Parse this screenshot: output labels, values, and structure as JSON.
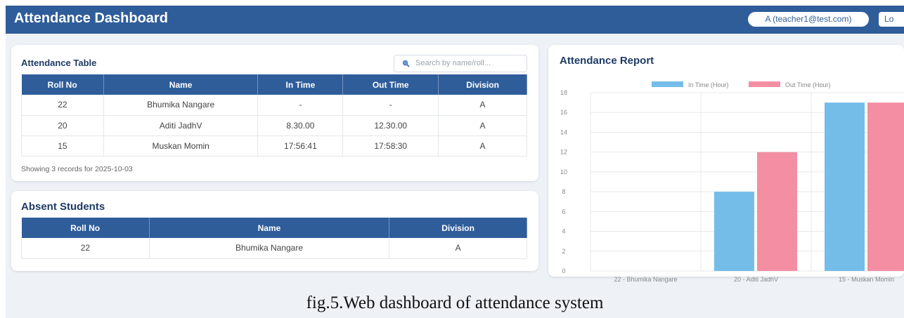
{
  "header": {
    "title": "Attendance Dashboard",
    "user_label": "A (teacher1@test.com)",
    "logout_label": "Lo"
  },
  "attendance_table": {
    "title": "Attendance Table",
    "search_placeholder": "Search by name/roll...",
    "columns": [
      "Roll No",
      "Name",
      "In Time",
      "Out Time",
      "Division"
    ],
    "rows": [
      [
        "22",
        "Bhumika Nangare",
        "-",
        "-",
        "A"
      ],
      [
        "20",
        "Aditi JadhV",
        "8.30.00",
        "12.30.00",
        "A"
      ],
      [
        "15",
        "Muskan Momin",
        "17:56:41",
        "17:58:30",
        "A"
      ]
    ],
    "footer_note": "Showing 3 records for 2025-10-03"
  },
  "absent_students": {
    "title": "Absent Students",
    "columns": [
      "Roll No",
      "Name",
      "Division"
    ],
    "rows": [
      [
        "22",
        "Bhumika Nangare",
        "A"
      ]
    ]
  },
  "report": {
    "title": "Attendance Report"
  },
  "chart_data": {
    "type": "bar",
    "categories": [
      "22 - Bhumika Nangare",
      "20 - Aditi JadhV",
      "15 - Muskan Momin"
    ],
    "series": [
      {
        "name": "In Time (Hour)",
        "values": [
          0,
          8,
          17
        ],
        "color": "#74bde9"
      },
      {
        "name": "Out Time (Hour)",
        "values": [
          0,
          12,
          17
        ],
        "color": "#f48fa3"
      }
    ],
    "yticks": [
      0,
      2,
      4,
      6,
      8,
      10,
      12,
      14,
      16,
      18
    ],
    "ylim": [
      0,
      18
    ],
    "grid": true,
    "legend_position": "top-center"
  },
  "caption": "fig.5.Web dashboard of attendance system",
  "colors": {
    "header_blue": "#2f5d9a",
    "in_time": "#74bde9",
    "out_time": "#f48fa3"
  }
}
